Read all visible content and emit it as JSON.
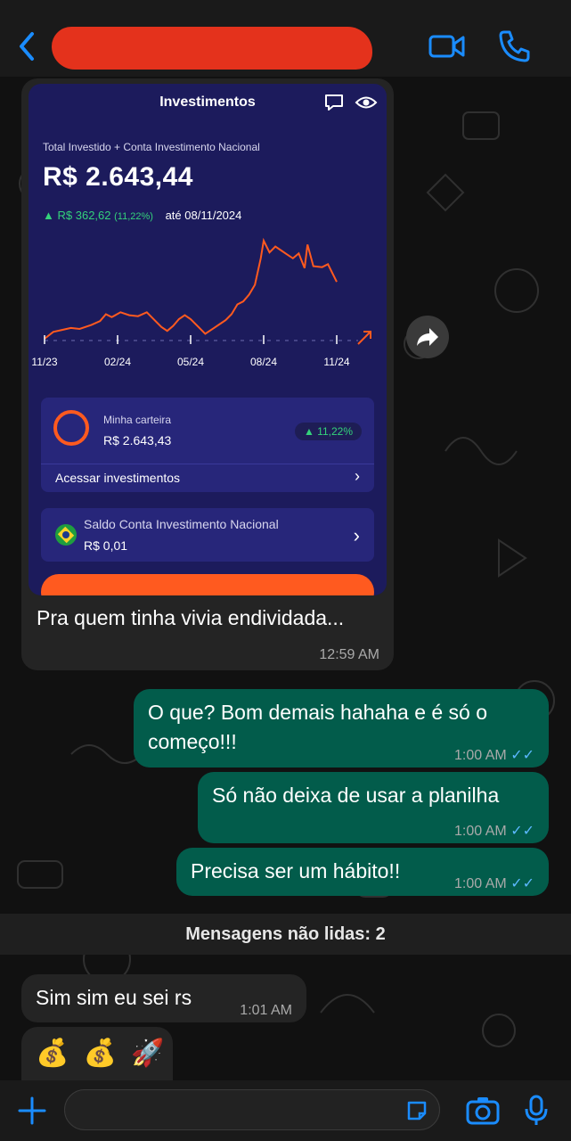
{
  "colors": {
    "accent": "#1a8cff",
    "outgoing": "#025c4b",
    "incoming": "#242424",
    "redaction": "#e4321c",
    "chart_line": "#ff5a1f",
    "positive": "#34d27b"
  },
  "screenshot": {
    "title": "Investimentos",
    "total_label": "Total Investido + Conta Investimento Nacional",
    "total_value": "R$ 2.643,44",
    "gain_value": "R$ 362,62",
    "gain_pct": "(11,22%)",
    "gain_date": "até 08/11/2024",
    "portfolio_label": "Minha carteira",
    "portfolio_value": "R$ 2.643,43",
    "portfolio_badge": "▲ 11,22%",
    "access_label": "Acessar investimentos",
    "balance_label": "Saldo Conta Investimento Nacional",
    "balance_value": "R$ 0,01"
  },
  "chart_data": {
    "type": "line",
    "x_tick_labels": [
      "11/23",
      "02/24",
      "05/24",
      "08/24",
      "11/24"
    ],
    "values": [
      [
        0,
        0
      ],
      [
        0.03,
        0.07
      ],
      [
        0.06,
        0.09
      ],
      [
        0.09,
        0.11
      ],
      [
        0.12,
        0.1
      ],
      [
        0.16,
        0.14
      ],
      [
        0.19,
        0.18
      ],
      [
        0.21,
        0.25
      ],
      [
        0.23,
        0.22
      ],
      [
        0.26,
        0.27
      ],
      [
        0.29,
        0.24
      ],
      [
        0.32,
        0.23
      ],
      [
        0.35,
        0.27
      ],
      [
        0.37,
        0.21
      ],
      [
        0.4,
        0.12
      ],
      [
        0.42,
        0.08
      ],
      [
        0.44,
        0.13
      ],
      [
        0.46,
        0.2
      ],
      [
        0.48,
        0.24
      ],
      [
        0.5,
        0.2
      ],
      [
        0.52,
        0.14
      ],
      [
        0.55,
        0.05
      ],
      [
        0.58,
        0.11
      ],
      [
        0.6,
        0.15
      ],
      [
        0.62,
        0.19
      ],
      [
        0.64,
        0.25
      ],
      [
        0.66,
        0.35
      ],
      [
        0.68,
        0.38
      ],
      [
        0.7,
        0.45
      ],
      [
        0.72,
        0.55
      ],
      [
        0.74,
        0.82
      ],
      [
        0.75,
        1.0
      ],
      [
        0.77,
        0.88
      ],
      [
        0.79,
        0.94
      ],
      [
        0.81,
        0.9
      ],
      [
        0.83,
        0.86
      ],
      [
        0.85,
        0.82
      ],
      [
        0.87,
        0.87
      ],
      [
        0.89,
        0.72
      ],
      [
        0.9,
        0.96
      ],
      [
        0.92,
        0.74
      ],
      [
        0.95,
        0.73
      ],
      [
        0.97,
        0.76
      ],
      [
        1.0,
        0.58
      ]
    ]
  },
  "header": {
    "back_icon": "chevron-left-icon",
    "video_icon": "video-call-icon",
    "phone_icon": "phone-icon"
  },
  "messages": [
    {
      "id": "m1",
      "type": "incoming",
      "text": "Pra quem tinha vivia endividada...",
      "time": "12:59 AM"
    },
    {
      "id": "m2",
      "type": "outgoing",
      "text": "O que? Bom demais hahaha e é só o começo!!!",
      "time": "1:00 AM"
    },
    {
      "id": "m3",
      "type": "outgoing",
      "text": "Só não deixa de usar a planilha",
      "time": "1:00 AM"
    },
    {
      "id": "m4",
      "type": "outgoing",
      "text": "Precisa ser um hábito!!",
      "time": "1:00 AM"
    },
    {
      "id": "m5",
      "type": "incoming",
      "text": "Sim sim eu sei rs",
      "time": "1:01 AM"
    },
    {
      "id": "m6",
      "type": "incoming",
      "text": "💰 💰 🚀"
    }
  ],
  "unread_banner": "Mensagens não lidas: 2",
  "input": {
    "placeholder": ""
  },
  "ticks": "✓✓"
}
